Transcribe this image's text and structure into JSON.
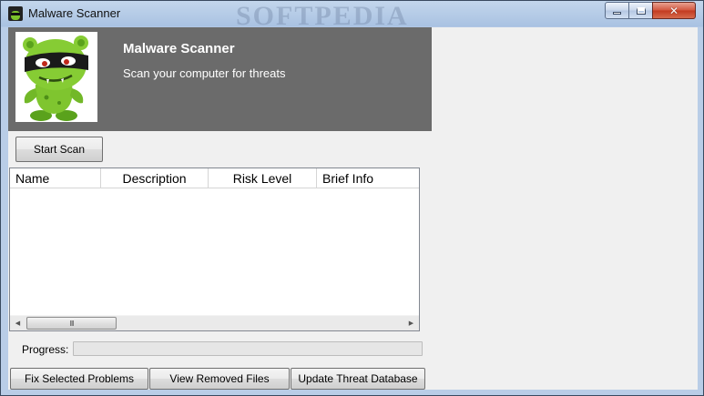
{
  "window": {
    "title": "Malware Scanner",
    "watermark": "SOFTPEDIA",
    "controls": {
      "minimize_icon": "minimize-icon",
      "maximize_icon": "maximize-icon",
      "close_icon": "close-icon"
    }
  },
  "header": {
    "title": "Malware Scanner",
    "subtitle": "Scan your computer for threats",
    "background_color": "#6b6b6b",
    "mascot_icon": "green-monster-mascot-icon"
  },
  "toolbar": {
    "start_scan_label": "Start Scan"
  },
  "results_list": {
    "columns": [
      "Name",
      "Description",
      "Risk Level",
      "Brief Info"
    ],
    "rows": [],
    "scrollbar_thumb_glyph": "III"
  },
  "progress": {
    "label": "Progress:",
    "value": 0
  },
  "actions": {
    "fix_label": "Fix Selected Problems",
    "view_removed_label": "View Removed Files",
    "update_db_label": "Update Threat Database"
  }
}
